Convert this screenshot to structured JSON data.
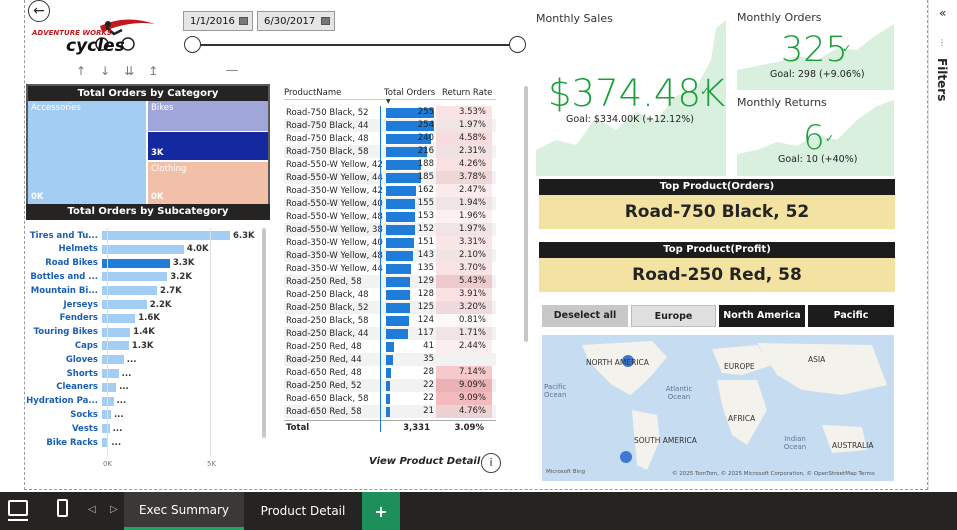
{
  "back": {
    "icon": "back-arrow-icon"
  },
  "logo": {
    "line1": "ADVENTURE WORKS",
    "line2": "cycles"
  },
  "date_filter": {
    "start": "1/1/2016",
    "end": "6/30/2017"
  },
  "treemap": {
    "title": "Total Orders by Category",
    "cells": [
      {
        "label": "Accessories",
        "value": "0K"
      },
      {
        "label": "Bikes",
        "value": "3K"
      },
      {
        "label": "Clothing",
        "value": "0K"
      }
    ]
  },
  "subcategory": {
    "title": "Total Orders by Subcategory",
    "axis": [
      "0K",
      "5K"
    ],
    "rows": [
      {
        "label": "Tires and Tu...",
        "value": "6.3K",
        "frac": 1.0
      },
      {
        "label": "Helmets",
        "value": "4.0K",
        "frac": 0.64
      },
      {
        "label": "Road Bikes",
        "value": "3.3K",
        "frac": 0.53
      },
      {
        "label": "Bottles and ...",
        "value": "3.2K",
        "frac": 0.51
      },
      {
        "label": "Mountain Bi...",
        "value": "2.7K",
        "frac": 0.43
      },
      {
        "label": "Jerseys",
        "value": "2.2K",
        "frac": 0.35
      },
      {
        "label": "Fenders",
        "value": "1.6K",
        "frac": 0.26
      },
      {
        "label": "Touring Bikes",
        "value": "1.4K",
        "frac": 0.22
      },
      {
        "label": "Caps",
        "value": "1.3K",
        "frac": 0.21
      },
      {
        "label": "Gloves",
        "value": "...",
        "frac": 0.17
      },
      {
        "label": "Shorts",
        "value": "...",
        "frac": 0.13
      },
      {
        "label": "Cleaners",
        "value": "...",
        "frac": 0.11
      },
      {
        "label": "Hydration Pa...",
        "value": "...",
        "frac": 0.09
      },
      {
        "label": "Socks",
        "value": "...",
        "frac": 0.07
      },
      {
        "label": "Vests",
        "value": "...",
        "frac": 0.06
      },
      {
        "label": "Bike Racks",
        "value": "...",
        "frac": 0.05
      }
    ]
  },
  "product_table": {
    "headers": [
      "ProductName",
      "Total Orders",
      "Return Rate"
    ],
    "rows": [
      {
        "name": "Road-750 Black, 52",
        "orders": "255",
        "rate": "3.53%"
      },
      {
        "name": "Road-750 Black, 44",
        "orders": "254",
        "rate": "1.97%"
      },
      {
        "name": "Road-750 Black, 48",
        "orders": "240",
        "rate": "4.58%"
      },
      {
        "name": "Road-750 Black, 58",
        "orders": "216",
        "rate": "2.31%"
      },
      {
        "name": "Road-550-W Yellow, 42",
        "orders": "188",
        "rate": "4.26%"
      },
      {
        "name": "Road-550-W Yellow, 44",
        "orders": "185",
        "rate": "3.78%"
      },
      {
        "name": "Road-350-W Yellow, 42",
        "orders": "162",
        "rate": "2.47%"
      },
      {
        "name": "Road-550-W Yellow, 40",
        "orders": "155",
        "rate": "1.94%"
      },
      {
        "name": "Road-550-W Yellow, 48",
        "orders": "153",
        "rate": "1.96%"
      },
      {
        "name": "Road-550-W Yellow, 38",
        "orders": "152",
        "rate": "1.97%"
      },
      {
        "name": "Road-350-W Yellow, 40",
        "orders": "151",
        "rate": "3.31%"
      },
      {
        "name": "Road-350-W Yellow, 48",
        "orders": "143",
        "rate": "2.10%"
      },
      {
        "name": "Road-350-W Yellow, 44",
        "orders": "135",
        "rate": "3.70%"
      },
      {
        "name": "Road-250 Red, 58",
        "orders": "129",
        "rate": "5.43%"
      },
      {
        "name": "Road-250 Black, 48",
        "orders": "128",
        "rate": "3.91%"
      },
      {
        "name": "Road-250 Black, 52",
        "orders": "125",
        "rate": "3.20%"
      },
      {
        "name": "Road-250 Black, 58",
        "orders": "124",
        "rate": "0.81%"
      },
      {
        "name": "Road-250 Black, 44",
        "orders": "117",
        "rate": "1.71%"
      },
      {
        "name": "Road-250 Red, 48",
        "orders": "41",
        "rate": "2.44%"
      },
      {
        "name": "Road-250 Red, 44",
        "orders": "35",
        "rate": ""
      },
      {
        "name": "Road-650 Red, 48",
        "orders": "28",
        "rate": "7.14%"
      },
      {
        "name": "Road-250 Red, 52",
        "orders": "22",
        "rate": "9.09%"
      },
      {
        "name": "Road-650 Black, 58",
        "orders": "22",
        "rate": "9.09%"
      },
      {
        "name": "Road-650 Red, 58",
        "orders": "21",
        "rate": "4.76%"
      }
    ],
    "total": {
      "label": "Total",
      "orders": "3,331",
      "rate": "3.09%"
    },
    "max_orders": 255
  },
  "view_detail": {
    "label": "View Product Detail",
    "icon": "info-icon"
  },
  "monthly_sales": {
    "label": "Monthly Sales",
    "value": "$374.48K",
    "goal": "Goal: $334.00K (+12.12%)"
  },
  "monthly_orders": {
    "label": "Monthly Orders",
    "value": "325",
    "goal": "Goal: 298 (+9.06%)"
  },
  "monthly_returns": {
    "label": "Monthly Returns",
    "value": "6",
    "goal": "Goal: 10 (+40%)"
  },
  "top_orders": {
    "title": "Top Product(Orders)",
    "value": "Road-750 Black, 52"
  },
  "top_profit": {
    "title": "Top Product(Profit)",
    "value": "Road-250 Red, 58"
  },
  "regions": {
    "deselect": "Deselect all",
    "items": [
      "Europe",
      "North America",
      "Pacific"
    ]
  },
  "map": {
    "labels": [
      "NORTH AMERICA",
      "EUROPE",
      "ASIA",
      "Atlantic Ocean",
      "Pacific Ocean",
      "AFRICA",
      "SOUTH AMERICA",
      "Indian Ocean",
      "AUSTRALIA"
    ],
    "attribution": "© 2025 TomTom, © 2025 Microsoft Corporation, © OpenStreetMap  Terms",
    "brand": "Microsoft Bing"
  },
  "filters": {
    "label": "Filters",
    "icon": "collapse-chevron-icon"
  },
  "bottom_tabs": {
    "tabs": [
      "Exec Summary",
      "Product Detail"
    ],
    "add": "+"
  },
  "colors": {
    "accent_green": "#1a9e3a",
    "bar_blue": "#1f7cd8",
    "light_blue": "#a3cdf3",
    "card_bg": "#d9f0de",
    "yellow": "#f3e3a3"
  }
}
